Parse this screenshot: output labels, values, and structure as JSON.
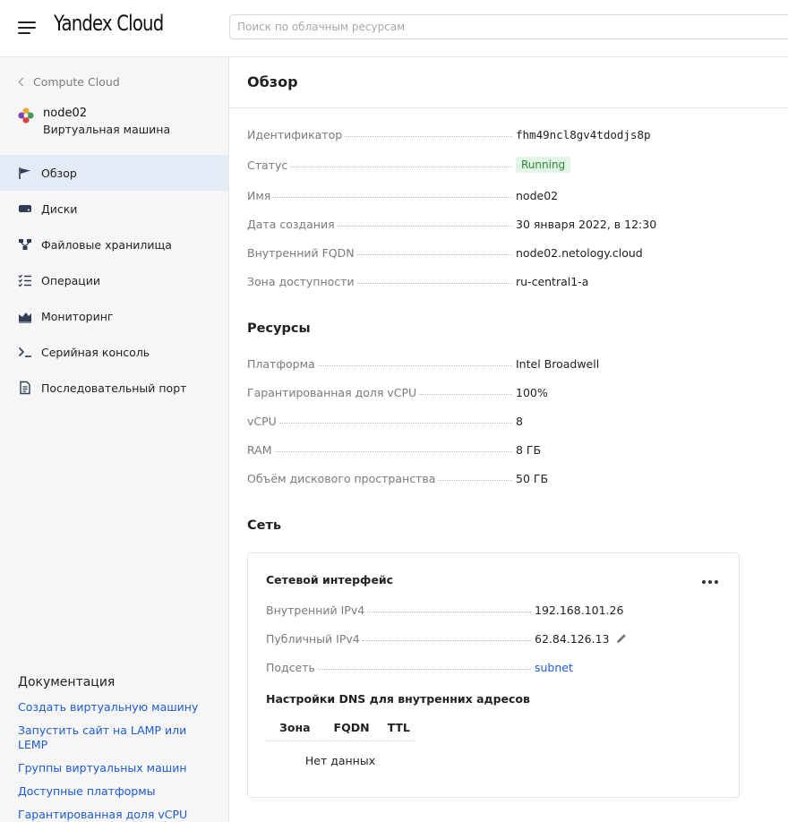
{
  "header": {
    "logo": "Yandex Cloud",
    "search_placeholder": "Поиск по облачным ресурсам"
  },
  "sidebar": {
    "back_label": "Compute Cloud",
    "resource_name": "node02",
    "resource_type": "Виртуальная машина",
    "items": [
      {
        "label": "Обзор",
        "icon": "flag-icon",
        "active": true
      },
      {
        "label": "Диски",
        "icon": "disk-icon"
      },
      {
        "label": "Файловые хранилища",
        "icon": "file-storage-icon"
      },
      {
        "label": "Операции",
        "icon": "operations-list-icon"
      },
      {
        "label": "Мониторинг",
        "icon": "monitoring-chart-icon"
      },
      {
        "label": "Серийная консоль",
        "icon": "terminal-icon"
      },
      {
        "label": "Последовательный порт",
        "icon": "document-icon"
      }
    ],
    "docs": {
      "title": "Документация",
      "links": [
        "Создать виртуальную машину",
        "Запустить сайт на LAMP или LEMP",
        "Группы виртуальных машин",
        "Доступные платформы",
        "Гарантированная доля vCPU"
      ]
    }
  },
  "main": {
    "title": "Обзор",
    "overview": {
      "id_label": "Идентификатор",
      "id_value": "fhm49ncl8gv4tdodjs8p",
      "status_label": "Статус",
      "status_value": "Running",
      "name_label": "Имя",
      "name_value": "node02",
      "created_label": "Дата создания",
      "created_value": "30 января 2022, в 12:30",
      "fqdn_label": "Внутренний FQDN",
      "fqdn_value": "node02.netology.cloud",
      "zone_label": "Зона доступности",
      "zone_value": "ru-central1-a"
    },
    "resources": {
      "title": "Ресурсы",
      "platform_label": "Платформа",
      "platform_value": "Intel Broadwell",
      "vcpu_share_label": "Гарантированная доля vCPU",
      "vcpu_share_value": "100%",
      "vcpu_label": "vCPU",
      "vcpu_value": "8",
      "ram_label": "RAM",
      "ram_value": "8 ГБ",
      "disk_label": "Объём дискового пространства",
      "disk_value": "50 ГБ"
    },
    "network": {
      "title": "Сеть",
      "card_title": "Сетевой интерфейс",
      "internal_ip_label": "Внутренний IPv4",
      "internal_ip_value": "192.168.101.26",
      "public_ip_label": "Публичный IPv4",
      "public_ip_value": "62.84.126.13",
      "subnet_label": "Подсеть",
      "subnet_value": "subnet",
      "dns_title": "Настройки DNS для внутренних адресов",
      "dns_columns": [
        "Зона",
        "FQDN",
        "TTL"
      ],
      "dns_empty": "Нет данных"
    }
  },
  "colors": {
    "accent_link": "#1d5bd6",
    "active_nav_bg": "#e5ebf6",
    "status_bg": "#e3f6e5",
    "status_text": "#2a8a34"
  }
}
